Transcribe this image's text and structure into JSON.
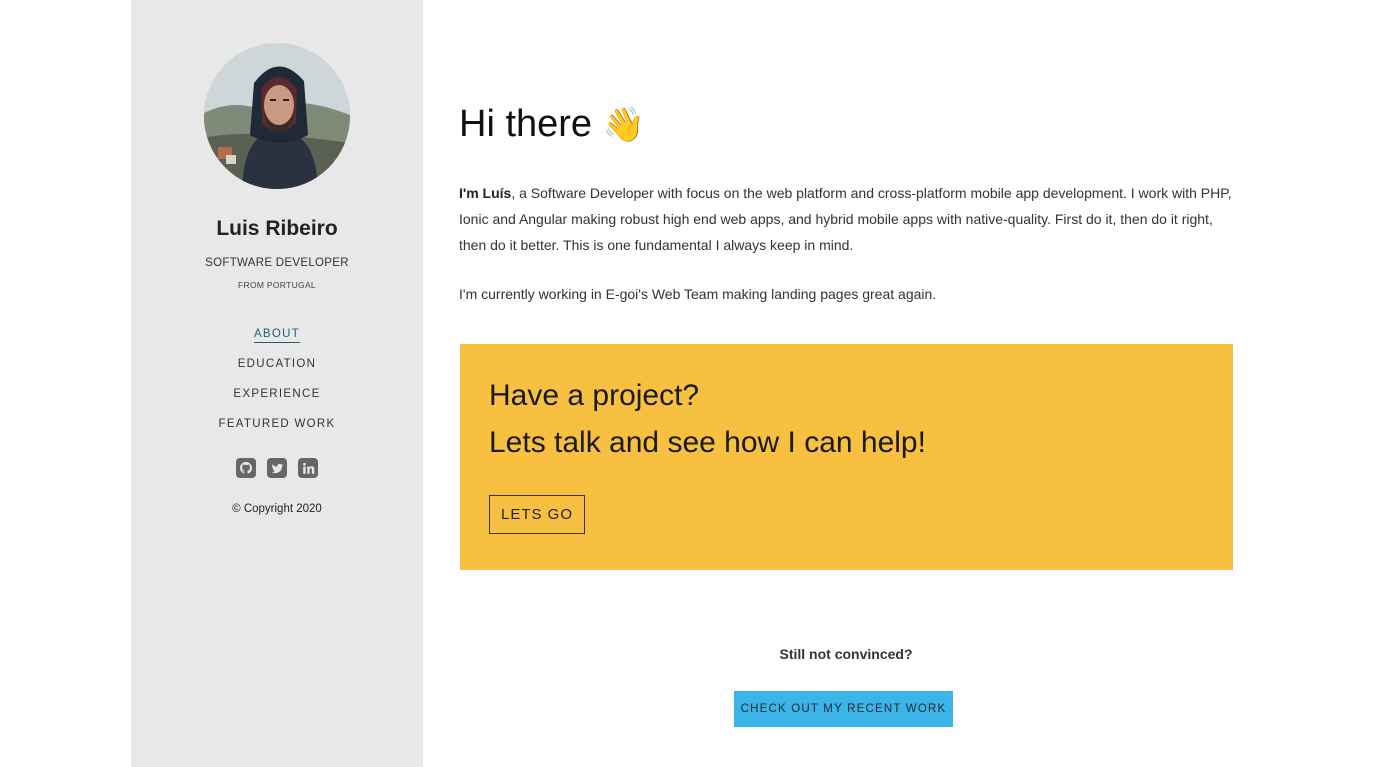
{
  "sidebar": {
    "avatar_alt": "Luis Ribeiro",
    "name": "Luis Ribeiro",
    "title": "SOFTWARE DEVELOPER",
    "location": "FROM PORTUGAL",
    "nav": [
      {
        "label": "ABOUT",
        "active": true
      },
      {
        "label": "EDUCATION",
        "active": false
      },
      {
        "label": "EXPERIENCE",
        "active": false
      },
      {
        "label": "FEATURED WORK",
        "active": false
      }
    ],
    "socials": [
      {
        "icon": "github-icon"
      },
      {
        "icon": "twitter-icon"
      },
      {
        "icon": "linkedin-icon"
      }
    ],
    "copyright": "© Copyright 2020"
  },
  "main": {
    "greeting": "Hi there",
    "greeting_emoji": "👋",
    "intro_name": "I'm Luís",
    "intro_rest": ", a Software Developer with focus on the web platform and cross-platform mobile app development. I work with PHP, Ionic and Angular making robust high end web apps, and hybrid mobile apps with native-quality. First do it, then do it right, then do it better. This is one fundamental I always keep in mind.",
    "current_work": "I'm currently working in E-goi's Web Team making landing pages great again.",
    "cta": {
      "line1": "Have a project?",
      "line2": "Lets talk and see how I can help!",
      "button": "LETS GO"
    },
    "still_not_convinced": "Still not convinced?",
    "work_button": "CHECK OUT MY RECENT WORK"
  },
  "colors": {
    "sidebar_bg": "#e8e8e8",
    "cta_bg": "#f8c040",
    "work_button_bg": "#3bb5e8",
    "active_nav": "#1f5f7a"
  }
}
